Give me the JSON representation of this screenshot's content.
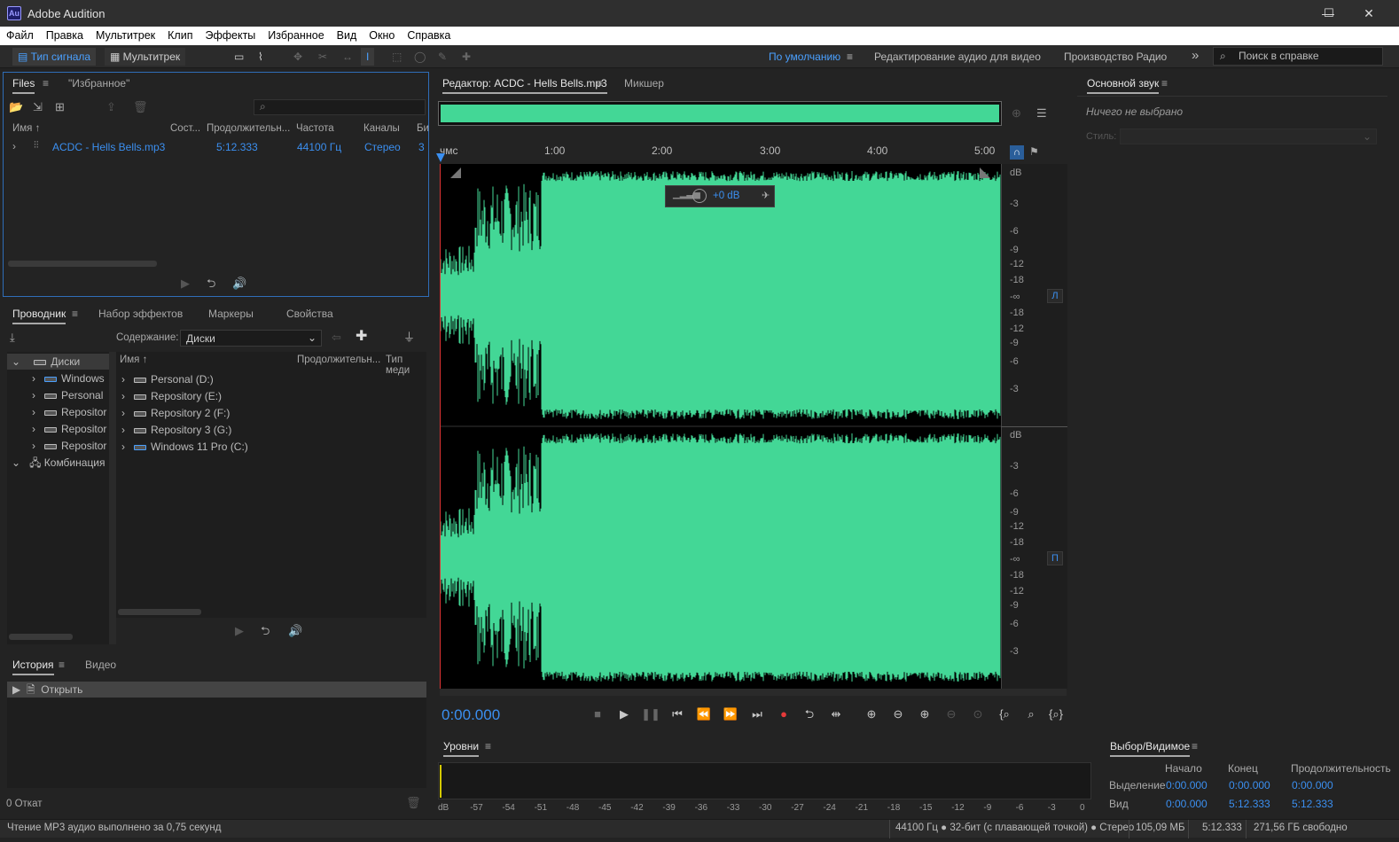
{
  "window": {
    "app_icon": "Au",
    "title": "Adobe Audition",
    "minimize": "—",
    "maximize": "☐",
    "close": "✕"
  },
  "menu": [
    "Файл",
    "Правка",
    "Мультитрек",
    "Клип",
    "Эффекты",
    "Избранное",
    "Вид",
    "Окно",
    "Справка"
  ],
  "toolbar": {
    "waveform_mode": "Тип сигнала",
    "multitrack_mode": "Мультитрек",
    "workspaces": [
      "По умолчанию",
      "Редактирование аудио для видео",
      "Производство Радио"
    ],
    "more": "»",
    "search_placeholder": "Поиск в справке"
  },
  "files_panel": {
    "tabs": [
      "Files",
      "\"Избранное\""
    ],
    "columns": [
      "Имя",
      "Сост...",
      "Продолжительн...",
      "Частота",
      "Каналы",
      "Би"
    ],
    "rows": [
      {
        "name": "ACDC - Hells Bells.mp3",
        "duration": "5:12.333",
        "rate": "44100 Гц",
        "channels": "Стерео",
        "bits": "3"
      }
    ]
  },
  "explorer_panel": {
    "tabs": [
      "Проводник",
      "Набор эффектов",
      "Маркеры",
      "Свойства"
    ],
    "content_label": "Содержание:",
    "content_value": "Диски",
    "tree": [
      {
        "label": "Диски",
        "level": 0
      },
      {
        "label": "Windows",
        "level": 1
      },
      {
        "label": "Personal",
        "level": 1
      },
      {
        "label": "Repositor",
        "level": 1
      },
      {
        "label": "Repositor",
        "level": 1
      },
      {
        "label": "Repositor",
        "level": 1
      },
      {
        "label": "Комбинация",
        "level": 0
      }
    ],
    "columns": [
      "Имя",
      "Продолжительн...",
      "Тип меди"
    ],
    "items": [
      "Personal (D:)",
      "Repository (E:)",
      "Repository 2 (F:)",
      "Repository 3 (G:)",
      "Windows 11 Pro (C:)"
    ]
  },
  "history_panel": {
    "tabs": [
      "История",
      "Видео"
    ],
    "entries": [
      "Открыть"
    ],
    "undo_label": "0 Откат"
  },
  "editor": {
    "tab_title": "Редактор: ACDC - Hells Bells.mp3",
    "mixer_tab": "Микшер",
    "time_labels": [
      "чмс",
      "1:00",
      "2:00",
      "3:00",
      "4:00",
      "5:00"
    ],
    "hud_gain": "+0 dB",
    "db_scale_top": [
      "dB",
      "-3",
      "-6",
      "-9",
      "-12",
      "-18",
      "-∞",
      "-18",
      "-12",
      "-9",
      "-6",
      "-3"
    ],
    "db_scale_bottom": [
      "dB",
      "-3",
      "-6",
      "-9",
      "-12",
      "-18",
      "-∞",
      "-18",
      "-12",
      "-9",
      "-6",
      "-3"
    ],
    "channel_left": "Л",
    "channel_right": "П",
    "current_time": "0:00.000",
    "waveform_color": "#43d796"
  },
  "essential_sound": {
    "title": "Основной звук",
    "nothing_selected": "Ничего не выбрано",
    "style_label": "Стиль:"
  },
  "levels": {
    "title": "Уровни",
    "scale": [
      "dB",
      "-57",
      "-54",
      "-51",
      "-48",
      "-45",
      "-42",
      "-39",
      "-36",
      "-33",
      "-30",
      "-27",
      "-24",
      "-21",
      "-18",
      "-15",
      "-12",
      "-9",
      "-6",
      "-3",
      "0"
    ]
  },
  "selection": {
    "title": "Выбор/Видимое",
    "headers": [
      "Начало",
      "Конец",
      "Продолжительность"
    ],
    "rows": [
      {
        "label": "Выделение",
        "start": "0:00.000",
        "end": "0:00.000",
        "duration": "0:00.000"
      },
      {
        "label": "Вид",
        "start": "0:00.000",
        "end": "5:12.333",
        "duration": "5:12.333"
      }
    ]
  },
  "status": {
    "message": "Чтение MP3 аудио выполнено за 0,75 секунд",
    "format": "44100 Гц ● 32-бит (с плавающей точкой) ● Стерео",
    "size": "105,09 МБ",
    "duration": "5:12.333",
    "free": "271,56 ГБ свободно"
  }
}
